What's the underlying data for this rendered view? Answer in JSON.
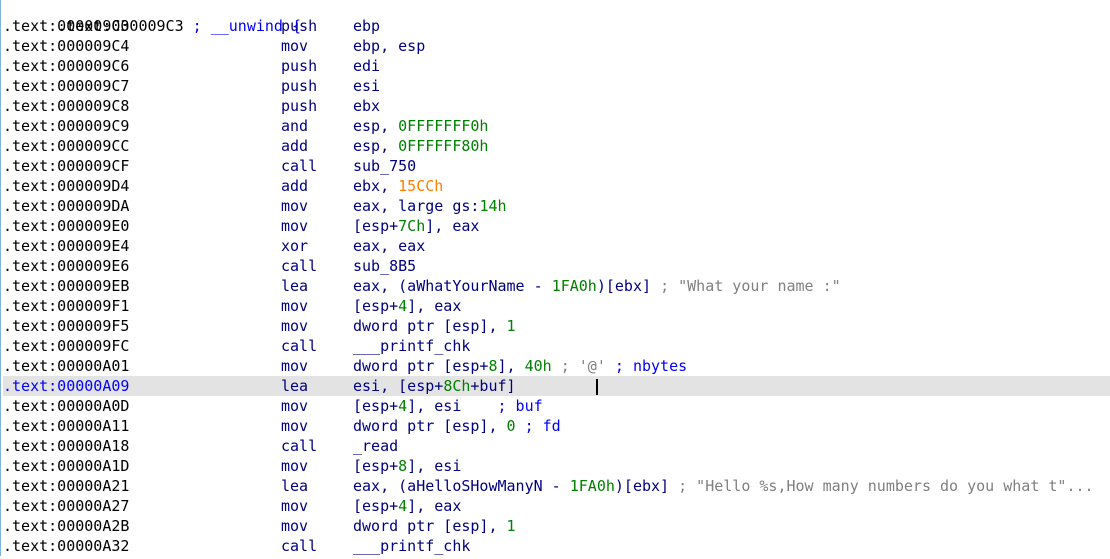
{
  "window": {
    "title": ""
  },
  "listing": {
    "header": {
      "addr": ".text:000009C3",
      "comment": " ; __unwind {"
    },
    "selected_index": 19,
    "lines": [
      {
        "addr": ".text:000009C3",
        "mnem": "push",
        "ops": [
          {
            "t": "ebp",
            "c": "reg"
          }
        ]
      },
      {
        "addr": ".text:000009C4",
        "mnem": "mov",
        "ops": [
          {
            "t": "ebp, esp",
            "c": "reg"
          }
        ]
      },
      {
        "addr": ".text:000009C6",
        "mnem": "push",
        "ops": [
          {
            "t": "edi",
            "c": "reg"
          }
        ]
      },
      {
        "addr": ".text:000009C7",
        "mnem": "push",
        "ops": [
          {
            "t": "esi",
            "c": "reg"
          }
        ]
      },
      {
        "addr": ".text:000009C8",
        "mnem": "push",
        "ops": [
          {
            "t": "ebx",
            "c": "reg"
          }
        ]
      },
      {
        "addr": ".text:000009C9",
        "mnem": "and",
        "ops": [
          {
            "t": "esp, ",
            "c": "reg"
          },
          {
            "t": "0FFFFFFF0h",
            "c": "num"
          }
        ]
      },
      {
        "addr": ".text:000009CC",
        "mnem": "add",
        "ops": [
          {
            "t": "esp, ",
            "c": "reg"
          },
          {
            "t": "0FFFFFF80h",
            "c": "num"
          }
        ]
      },
      {
        "addr": ".text:000009CF",
        "mnem": "call",
        "ops": [
          {
            "t": "sub_750",
            "c": "reg"
          }
        ]
      },
      {
        "addr": ".text:000009D4",
        "mnem": "add",
        "ops": [
          {
            "t": "ebx, ",
            "c": "reg"
          },
          {
            "t": "15CCh",
            "c": "orange"
          }
        ]
      },
      {
        "addr": ".text:000009DA",
        "mnem": "mov",
        "ops": [
          {
            "t": "eax, large gs:",
            "c": "reg"
          },
          {
            "t": "14h",
            "c": "num"
          }
        ]
      },
      {
        "addr": ".text:000009E0",
        "mnem": "mov",
        "ops": [
          {
            "t": "[esp+",
            "c": "reg"
          },
          {
            "t": "7Ch",
            "c": "num"
          },
          {
            "t": "], eax",
            "c": "reg"
          }
        ]
      },
      {
        "addr": ".text:000009E4",
        "mnem": "xor",
        "ops": [
          {
            "t": "eax, eax",
            "c": "reg"
          }
        ]
      },
      {
        "addr": ".text:000009E6",
        "mnem": "call",
        "ops": [
          {
            "t": "sub_8B5",
            "c": "reg"
          }
        ]
      },
      {
        "addr": ".text:000009EB",
        "mnem": "lea",
        "ops": [
          {
            "t": "eax, (aWhatYourName - ",
            "c": "reg"
          },
          {
            "t": "1FA0h",
            "c": "num"
          },
          {
            "t": ")[ebx] ",
            "c": "reg"
          },
          {
            "t": "; \"What your name :\"",
            "c": "cmt"
          }
        ]
      },
      {
        "addr": ".text:000009F1",
        "mnem": "mov",
        "ops": [
          {
            "t": "[esp+",
            "c": "reg"
          },
          {
            "t": "4",
            "c": "num"
          },
          {
            "t": "], eax",
            "c": "reg"
          }
        ]
      },
      {
        "addr": ".text:000009F5",
        "mnem": "mov",
        "ops": [
          {
            "t": "dword ptr [esp], ",
            "c": "reg"
          },
          {
            "t": "1",
            "c": "num"
          }
        ]
      },
      {
        "addr": ".text:000009FC",
        "mnem": "call",
        "ops": [
          {
            "t": "___printf_chk",
            "c": "reg"
          }
        ]
      },
      {
        "addr": ".text:00000A01",
        "mnem": "mov",
        "ops": [
          {
            "t": "dword ptr [esp+",
            "c": "reg"
          },
          {
            "t": "8",
            "c": "num"
          },
          {
            "t": "], ",
            "c": "reg"
          },
          {
            "t": "40h",
            "c": "num"
          },
          {
            "t": " ; '@' ",
            "c": "cmt"
          },
          {
            "t": "; nbytes",
            "c": "blue"
          }
        ]
      },
      {
        "addr": ".text:00000A09",
        "mnem": "lea",
        "ops": [
          {
            "t": "esi, [esp+",
            "c": "reg"
          },
          {
            "t": "8Ch",
            "c": "num"
          },
          {
            "t": "+buf]",
            "c": "reg"
          }
        ]
      },
      {
        "addr": ".text:00000A0D",
        "mnem": "mov",
        "ops": [
          {
            "t": "[esp+",
            "c": "reg"
          },
          {
            "t": "4",
            "c": "num"
          },
          {
            "t": "], esi    ",
            "c": "reg"
          },
          {
            "t": "; buf",
            "c": "blue"
          }
        ]
      },
      {
        "addr": ".text:00000A11",
        "mnem": "mov",
        "ops": [
          {
            "t": "dword ptr [esp], ",
            "c": "reg"
          },
          {
            "t": "0",
            "c": "num"
          },
          {
            "t": " ; fd",
            "c": "blue"
          }
        ]
      },
      {
        "addr": ".text:00000A18",
        "mnem": "call",
        "ops": [
          {
            "t": "_read",
            "c": "reg"
          }
        ]
      },
      {
        "addr": ".text:00000A1D",
        "mnem": "mov",
        "ops": [
          {
            "t": "[esp+",
            "c": "reg"
          },
          {
            "t": "8",
            "c": "num"
          },
          {
            "t": "], esi",
            "c": "reg"
          }
        ]
      },
      {
        "addr": ".text:00000A21",
        "mnem": "lea",
        "ops": [
          {
            "t": "eax, (aHelloSHowManyN - ",
            "c": "reg"
          },
          {
            "t": "1FA0h",
            "c": "num"
          },
          {
            "t": ")[ebx] ",
            "c": "reg"
          },
          {
            "t": "; \"Hello %s,How many numbers do you what t\"...",
            "c": "cmt"
          }
        ]
      },
      {
        "addr": ".text:00000A27",
        "mnem": "mov",
        "ops": [
          {
            "t": "[esp+",
            "c": "reg"
          },
          {
            "t": "4",
            "c": "num"
          },
          {
            "t": "], eax",
            "c": "reg"
          }
        ]
      },
      {
        "addr": ".text:00000A2B",
        "mnem": "mov",
        "ops": [
          {
            "t": "dword ptr [esp], ",
            "c": "reg"
          },
          {
            "t": "1",
            "c": "num"
          }
        ]
      },
      {
        "addr": ".text:00000A32",
        "mnem": "call",
        "ops": [
          {
            "t": "___printf_chk",
            "c": "reg"
          }
        ]
      }
    ]
  },
  "colors": {
    "register": "#000080",
    "number": "#008000",
    "immediate_highlight": "#ff8000",
    "comment": "#808080",
    "named_comment": "#0000ff",
    "selection": "#e3e3e3"
  }
}
